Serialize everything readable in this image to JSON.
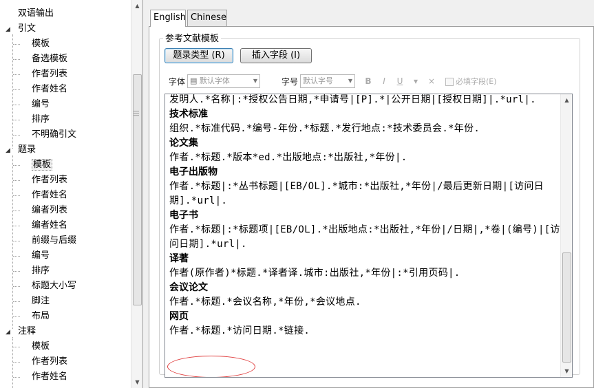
{
  "tree": {
    "items": [
      {
        "label": "双语输出",
        "level": 0,
        "toggle": ""
      },
      {
        "label": "引文",
        "level": 0,
        "toggle": "◢"
      },
      {
        "label": "模板",
        "level": 1
      },
      {
        "label": "备选模板",
        "level": 1
      },
      {
        "label": "作者列表",
        "level": 1
      },
      {
        "label": "作者姓名",
        "level": 1
      },
      {
        "label": "编号",
        "level": 1
      },
      {
        "label": "排序",
        "level": 1
      },
      {
        "label": "不明确引文",
        "level": 1
      },
      {
        "label": "题录",
        "level": 0,
        "toggle": "◢"
      },
      {
        "label": "模板",
        "level": 1,
        "selected": true
      },
      {
        "label": "作者列表",
        "level": 1
      },
      {
        "label": "作者姓名",
        "level": 1
      },
      {
        "label": "编者列表",
        "level": 1
      },
      {
        "label": "编者姓名",
        "level": 1
      },
      {
        "label": "前缀与后缀",
        "level": 1
      },
      {
        "label": "编号",
        "level": 1
      },
      {
        "label": "排序",
        "level": 1
      },
      {
        "label": "标题大小写",
        "level": 1
      },
      {
        "label": "脚注",
        "level": 1
      },
      {
        "label": "布局",
        "level": 1
      },
      {
        "label": "注释",
        "level": 0,
        "toggle": "◢"
      },
      {
        "label": "模板",
        "level": 1
      },
      {
        "label": "作者列表",
        "level": 1
      },
      {
        "label": "作者姓名",
        "level": 1
      }
    ]
  },
  "tabs": [
    {
      "label": "English",
      "active": true
    },
    {
      "label": "Chinese",
      "active": false
    }
  ],
  "group": {
    "title": "参考文献模板"
  },
  "buttons": {
    "record_type": "题录类型 (R)",
    "insert_field": "插入字段 (I)"
  },
  "format_bar": {
    "font_label": "字体",
    "font_value": "默认字体",
    "size_label": "字号",
    "size_value": "默认字号",
    "bold": "B",
    "italic": "I",
    "underline": "U",
    "clear": "×",
    "required_label": "必填字段(E)"
  },
  "editor": {
    "entries": [
      {
        "title": "",
        "body": "发明人.*名称|:*授权公告日期,*申请号|[P].*|公开日期|[授权日期]|.*url|."
      },
      {
        "title": "技术标准",
        "body": "组织.*标准代码.*编号-年份.*标题.*发行地点:*技术委员会.*年份."
      },
      {
        "title": "论文集",
        "body": "作者.*标题.*版本*ed.*出版地点:*出版社,*年份|."
      },
      {
        "title": "电子出版物",
        "body": "作者.*标题|:*丛书标题|[EB/OL].*城市:*出版社,*年份|/最后更新日期|[访问日期].*url|."
      },
      {
        "title": "电子书",
        "body": "作者.*标题|:*标题项|[EB/OL].*出版地点:*出版社,*年份|/日期|,*卷|(编号)|[访问日期].*url|."
      },
      {
        "title": "译著",
        "body": "作者(原作者)*标题.*译者译.城市:出版社,*年份|:*引用页码|."
      },
      {
        "title": "会议论文",
        "body": "作者.*标题.*会议名称,*年份,*会议地点."
      },
      {
        "title": "网页",
        "body": "作者.*标题.*访问日期.*链接."
      }
    ]
  },
  "colors": {
    "annotation": "#e04040",
    "selected_button_border": "#3c7fb1"
  }
}
